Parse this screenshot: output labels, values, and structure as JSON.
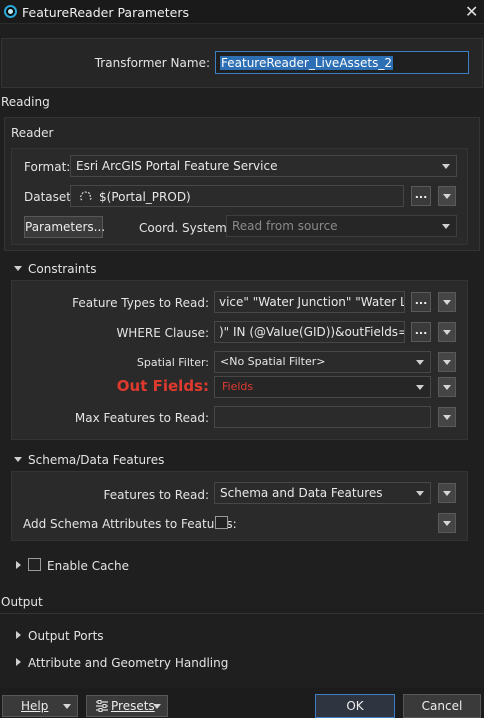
{
  "window": {
    "title": "FeatureReader Parameters",
    "close_symbol": "✕"
  },
  "transformer": {
    "label": "Transformer Name:",
    "value": "FeatureReader_LiveAssets_2"
  },
  "reading": {
    "section_label": "Reading",
    "reader_group": "Reader",
    "format_label": "Format:",
    "format_value": "Esri ArcGIS Portal Feature Service",
    "dataset_label": "Dataset:",
    "dataset_value": "$(Portal_PROD)",
    "dots_label": "...",
    "parameters_button": "Parameters...",
    "coord_label": "Coord. System:",
    "coord_placeholder": "Read from source"
  },
  "constraints": {
    "section_label": "Constraints",
    "feature_types_label": "Feature Types to Read:",
    "feature_types_value": "vice\" \"Water Junction\" \"Water Line\"",
    "where_label": "WHERE Clause:",
    "where_value": ")\" IN (@Value(GID))&outFields=GID",
    "spatial_label": "Spatial Filter:",
    "spatial_value": "<No Spatial Filter>",
    "out_fields_label": "Out Fields:",
    "out_fields_value": "Fields",
    "max_features_label": "Max Features to Read:",
    "max_features_value": ""
  },
  "schema": {
    "section_label": "Schema/Data Features",
    "features_to_read_label": "Features to Read:",
    "features_to_read_value": "Schema and Data Features",
    "add_schema_label": "Add Schema Attributes to Features:"
  },
  "cache": {
    "label": "Enable Cache"
  },
  "output": {
    "section_label": "Output",
    "ports_label": "Output Ports",
    "attr_geom_label": "Attribute and Geometry Handling"
  },
  "footer": {
    "help": "Help",
    "presets": "Presets",
    "ok": "OK",
    "cancel": "Cancel"
  },
  "colors": {
    "accent_blue": "#2aa9d9",
    "out_fields_red": "#e03a2f",
    "ok_border": "#3d7fc4"
  }
}
